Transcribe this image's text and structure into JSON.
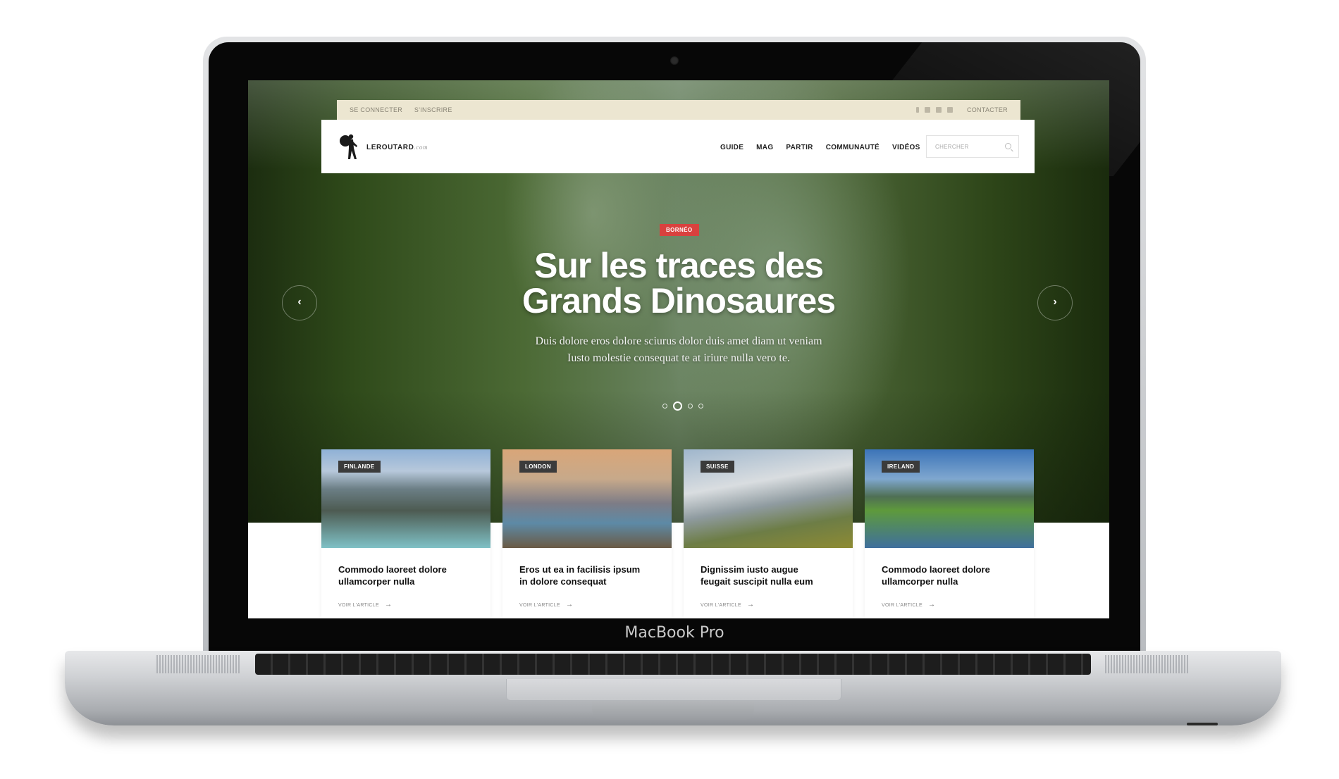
{
  "device": {
    "label": "MacBook Pro"
  },
  "site": {
    "topbar": {
      "login": "SE CONNECTER",
      "signup": "S'INSCRIRE",
      "social": [
        "facebook-icon",
        "twitter-icon",
        "youtube-icon",
        "instagram-icon"
      ],
      "contact": "CONTACTER"
    },
    "logo": {
      "name": "LEROUTARD",
      "suffix": ".com"
    },
    "nav": [
      "GUIDE",
      "MAG",
      "PARTIR",
      "COMMUNAUTÉ",
      "VIDÉOS"
    ],
    "search": {
      "placeholder": "CHERCHER"
    }
  },
  "hero": {
    "tag": "BORNÉO",
    "title_line1": "Sur les traces des",
    "title_line2": "Grands Dinosaures",
    "subtitle_line1": "Duis dolore eros dolore sciurus dolor duis amet diam ut veniam",
    "subtitle_line2": "Iusto molestie consequat te at iriure nulla vero te.",
    "slides": 4,
    "active_slide": 2,
    "prev_icon": "‹",
    "next_icon": "›"
  },
  "cards": [
    {
      "badge": "FINLANDE",
      "title_line1": "Commodo laoreet dolore",
      "title_line2": "ullamcorper nulla",
      "link": "VOIR L'ARTICLE"
    },
    {
      "badge": "LONDON",
      "title_line1": "Eros ut ea in facilisis ipsum",
      "title_line2": "in dolore consequat",
      "link": "VOIR L'ARTICLE"
    },
    {
      "badge": "SUISSE",
      "title_line1": "Dignissim iusto augue",
      "title_line2": "feugait suscipit nulla eum",
      "link": "VOIR L'ARTICLE"
    },
    {
      "badge": "IRELAND",
      "title_line1": "Commodo laoreet dolore",
      "title_line2": "ullamcorper nulla",
      "link": "VOIR L'ARTICLE"
    }
  ],
  "colors": {
    "accent": "#d9413e",
    "topbar": "#ece6d1",
    "badge": "#3b3b3b"
  }
}
